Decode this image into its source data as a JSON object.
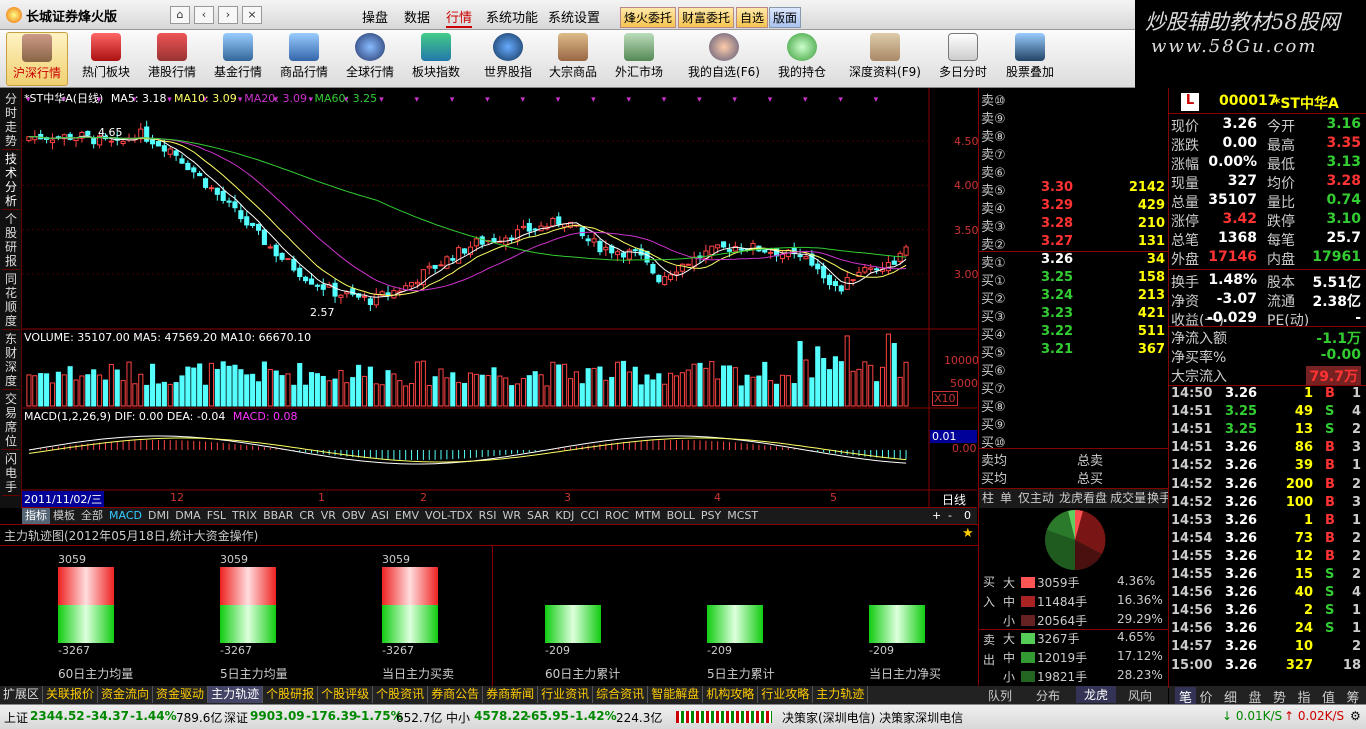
{
  "app": {
    "title": "长城证券烽火版",
    "brand_text": "炒股辅助教材58股网",
    "brand_url": "www.58Gu.com"
  },
  "menu": {
    "items": [
      "操盘",
      "数据",
      "行情",
      "系统功能",
      "系统设置"
    ],
    "active": "行情",
    "hot": [
      "烽火委托",
      "财富委托",
      "自选",
      "版面"
    ]
  },
  "toolbar": {
    "items": [
      "沪深行情",
      "热门板块",
      "港股行情",
      "基金行情",
      "商品行情",
      "全球行情",
      "板块指数",
      "世界股指",
      "大宗商品",
      "外汇市场",
      "我的自选(F6)",
      "我的持仓",
      "深度资料(F9)",
      "多日分时",
      "股票叠加"
    ],
    "active": "沪深行情"
  },
  "left_tabs": [
    "分时走势",
    "技术分析",
    "个股研报",
    "同花顺度",
    "东财深度",
    "交易席位",
    "闪电手"
  ],
  "chart": {
    "title": "*ST中华A(日线)",
    "ma": [
      {
        "label": "MA5: 3.18",
        "color": "#ffffff"
      },
      {
        "label": "MA10: 3.09",
        "color": "#ffff66"
      },
      {
        "label": "MA20: 3.09",
        "color": "#cc33cc"
      },
      {
        "label": "MA60: 3.25",
        "color": "#33cc33"
      }
    ],
    "price_axis": [
      "4.50",
      "4.00",
      "3.50",
      "3.00"
    ],
    "high_label": "4.65",
    "low_label": "2.57",
    "volume_info": "VOLUME: 35107.00  MA5: 47569.20  MA10: 66670.10",
    "volume_axis": [
      "10000",
      "5000",
      "X10"
    ],
    "macd_info": "MACD(1,2,26,9)  DIF: 0.00  DEA: -0.04",
    "macd_value": "MACD: 0.08",
    "macd_axis": [
      "0.01",
      "0.00"
    ],
    "date_label": "2011/11/02/三",
    "x_ticks": [
      "12",
      "1",
      "2",
      "3",
      "4",
      "5"
    ],
    "period": "日线",
    "indicators": [
      "指标",
      "模板",
      "全部",
      "MACD",
      "DMI",
      "DMA",
      "FSL",
      "TRIX",
      "BBAR",
      "CR",
      "VR",
      "OBV",
      "ASI",
      "EMV",
      "VOL-TDX",
      "RSI",
      "WR",
      "SAR",
      "KDJ",
      "CCI",
      "ROC",
      "MTM",
      "BOLL",
      "PSY",
      "MCST"
    ],
    "ind_controls": [
      "+",
      "-",
      "0"
    ]
  },
  "orderbook": {
    "asks_empty": [
      "卖⑩",
      "卖⑨",
      "卖⑧",
      "卖⑦",
      "卖⑥"
    ],
    "asks": [
      {
        "l": "卖⑤",
        "p": "3.30",
        "v": "2142"
      },
      {
        "l": "卖④",
        "p": "3.29",
        "v": "429"
      },
      {
        "l": "卖③",
        "p": "3.28",
        "v": "210"
      },
      {
        "l": "卖②",
        "p": "3.27",
        "v": "131"
      },
      {
        "l": "卖①",
        "p": "3.26",
        "v": "34"
      }
    ],
    "bids": [
      {
        "l": "买①",
        "p": "3.25",
        "v": "158"
      },
      {
        "l": "买②",
        "p": "3.24",
        "v": "213"
      },
      {
        "l": "买③",
        "p": "3.23",
        "v": "421"
      },
      {
        "l": "买④",
        "p": "3.22",
        "v": "511"
      },
      {
        "l": "买⑤",
        "p": "3.21",
        "v": "367"
      }
    ],
    "bids_empty": [
      "买⑥",
      "买⑦",
      "买⑧",
      "买⑨",
      "买⑩"
    ],
    "avg_sell": "卖均",
    "avg_buy": "买均",
    "total_sell": "总卖",
    "total_buy": "总买",
    "tabs": [
      "柱",
      "单",
      "仅主动",
      "龙虎看盘",
      "成交量",
      "换手"
    ],
    "buy_label": "买入",
    "sell_label": "卖出",
    "buy": [
      {
        "s": "大",
        "v": "3059手",
        "p": "4.36%"
      },
      {
        "s": "中",
        "v": "11484手",
        "p": "16.36%"
      },
      {
        "s": "小",
        "v": "20564手",
        "p": "29.29%"
      }
    ],
    "sell": [
      {
        "s": "大",
        "v": "3267手",
        "p": "4.65%"
      },
      {
        "s": "中",
        "v": "12019手",
        "p": "17.12%"
      },
      {
        "s": "小",
        "v": "19821手",
        "p": "28.23%"
      }
    ],
    "bottom_tabs": [
      "队列",
      "分布",
      "龙虎",
      "风向"
    ],
    "bottom_active": "龙虎"
  },
  "stock": {
    "code": "000017",
    "name": "*ST中华A",
    "badge": "L",
    "rows": [
      [
        "现价",
        "3.26",
        "今开",
        "3.16"
      ],
      [
        "涨跌",
        "0.00",
        "最高",
        "3.35"
      ],
      [
        "涨幅",
        "0.00%",
        "最低",
        "3.13"
      ],
      [
        "现量",
        "327",
        "均价",
        "3.28"
      ],
      [
        "总量",
        "35107",
        "量比",
        "0.74"
      ],
      [
        "涨停",
        "3.42",
        "跌停",
        "3.10"
      ],
      [
        "总笔",
        "1368",
        "每笔",
        "25.7"
      ],
      [
        "外盘",
        "17146",
        "内盘",
        "17961"
      ],
      [
        "换手",
        "1.48%",
        "股本",
        "5.51亿"
      ],
      [
        "净资",
        "-3.07",
        "流通",
        "2.38亿"
      ],
      [
        "收益(一)",
        "-0.029",
        "PE(动)",
        "-"
      ]
    ],
    "flow": [
      [
        "净流入额",
        "-1.1万"
      ],
      [
        "净买率%",
        "-0.00"
      ],
      [
        "大宗流入",
        "79.7万"
      ]
    ],
    "ticks": [
      [
        "14:50",
        "3.26",
        "1",
        "B",
        "1"
      ],
      [
        "14:51",
        "3.25",
        "49",
        "S",
        "4"
      ],
      [
        "14:51",
        "3.25",
        "13",
        "S",
        "2"
      ],
      [
        "14:51",
        "3.26",
        "86",
        "B",
        "3"
      ],
      [
        "14:52",
        "3.26",
        "39",
        "B",
        "1"
      ],
      [
        "14:52",
        "3.26",
        "200",
        "B",
        "2"
      ],
      [
        "14:52",
        "3.26",
        "100",
        "B",
        "3"
      ],
      [
        "14:53",
        "3.26",
        "1",
        "B",
        "1"
      ],
      [
        "14:54",
        "3.26",
        "73",
        "B",
        "2"
      ],
      [
        "14:55",
        "3.26",
        "12",
        "B",
        "2"
      ],
      [
        "14:55",
        "3.26",
        "15",
        "S",
        "2"
      ],
      [
        "14:56",
        "3.26",
        "40",
        "S",
        "4"
      ],
      [
        "14:56",
        "3.26",
        "2",
        "S",
        "1"
      ],
      [
        "14:56",
        "3.26",
        "24",
        "S",
        "1"
      ],
      [
        "14:57",
        "3.26",
        "10",
        "",
        "2"
      ],
      [
        "15:00",
        "3.26",
        "327",
        "",
        "18"
      ]
    ],
    "side_tabs": [
      "笔",
      "价",
      "细",
      "盘",
      "势",
      "指",
      "值",
      "筹"
    ]
  },
  "mainflow": {
    "title": "主力轨迹图(2012年05月18日,统计大资金操作)",
    "left": [
      {
        "top": "3059",
        "bottom": "-3267",
        "label": "60日主力均量"
      },
      {
        "top": "3059",
        "bottom": "-3267",
        "label": "5日主力均量"
      },
      {
        "top": "3059",
        "bottom": "-3267",
        "label": "当日主力买卖"
      }
    ],
    "right": [
      {
        "bottom": "-209",
        "label": "60日主力累计"
      },
      {
        "bottom": "-209",
        "label": "5日主力累计"
      },
      {
        "bottom": "-209",
        "label": "当日主力净买"
      }
    ]
  },
  "bottom_tabs": [
    "扩展区",
    "关联报价",
    "资金流向",
    "资金驱动",
    "主力轨迹",
    "个股研报",
    "个股评级",
    "个股资讯",
    "券商公告",
    "券商新闻",
    "行业资讯",
    "综合资讯",
    "智能解盘",
    "机构攻略",
    "行业攻略",
    "主力轨迹"
  ],
  "bottom_active": "主力轨迹",
  "status": {
    "sh_label": "上证",
    "sh": "2344.52",
    "sh_chg": "-34.37",
    "sh_pct": "-1.44%",
    "sh_amt": "789.6亿",
    "sz_label": "深证",
    "sz": "9903.09",
    "sz_chg": "-176.39",
    "sz_pct": "-1.75%",
    "sz_amt": "652.7亿",
    "zx_label": "中小",
    "zx": "4578.22",
    "zx_chg": "-65.95",
    "zx_pct": "-1.42%",
    "zx_amt": "224.3亿",
    "server": "决策家(深圳电信) 决策家深圳电信",
    "down": "0.01K/S",
    "up": "0.02K/S"
  }
}
